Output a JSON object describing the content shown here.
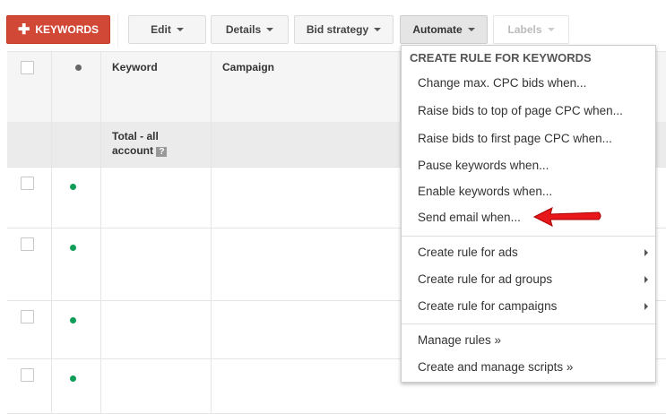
{
  "toolbar": {
    "add_keywords": "KEYWORDS",
    "edit": "Edit",
    "details": "Details",
    "bid_strategy": "Bid strategy",
    "automate": "Automate",
    "labels": "Labels"
  },
  "table": {
    "headers": {
      "keyword": "Keyword",
      "campaign": "Campaign"
    },
    "total_label": "Total - all account",
    "help": "?"
  },
  "colors": {
    "primary_button": "#d14836",
    "status_enabled": "#0f9d58",
    "arrow": "#e8171b"
  },
  "menu": {
    "header": "CREATE RULE FOR KEYWORDS",
    "items": [
      "Change max. CPC bids when...",
      "Raise bids to top of page CPC when...",
      "Raise bids to first page CPC when...",
      "Pause keywords when...",
      "Enable keywords when...",
      "Send email when..."
    ],
    "submenus": [
      "Create rule for ads",
      "Create rule for ad groups",
      "Create rule for campaigns"
    ],
    "links": [
      "Manage rules »",
      "Create and manage scripts »"
    ]
  }
}
